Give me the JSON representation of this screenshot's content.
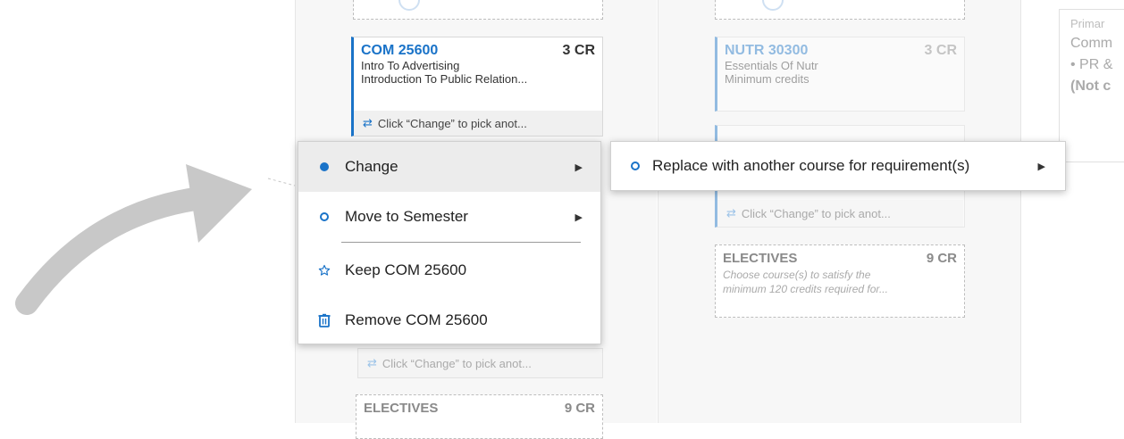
{
  "column_a": {
    "course_card": {
      "code": "COM 25600",
      "credits": "3 CR",
      "line1": "Intro To Advertising",
      "line2": "Introduction To Public Relation...",
      "hint": "Click “Change” to pick anot..."
    },
    "hint_below": "Click “Change” to pick anot...",
    "electives": {
      "title": "ELECTIVES",
      "credits": "9 CR"
    }
  },
  "column_b": {
    "course_card": {
      "code": "NUTR 30300",
      "credits": "3 CR",
      "line1": "Essentials Of Nutr",
      "line2": "Minimum credits"
    },
    "hint": "Click “Change” to pick anot...",
    "electives": {
      "title": "ELECTIVES",
      "credits": "9 CR",
      "desc_line1": "Choose course(s) to satisfy the",
      "desc_line2": "minimum 120 credits required for..."
    }
  },
  "side_panel": {
    "line1": "Primar",
    "line2": "Comm",
    "line3": "• PR &",
    "line4": "(Not c"
  },
  "context_menu": {
    "change_label": "Change",
    "move_label": "Move to Semester",
    "keep_label": "Keep COM 25600",
    "remove_label": "Remove COM 25600"
  },
  "submenu": {
    "replace_label": "Replace with another course for requirement(s)"
  },
  "icons": {
    "swap": "swap-arrows-icon",
    "star": "star-outline-icon",
    "trash": "trash-icon",
    "submenu_arrow": "caret-right-icon"
  },
  "colors": {
    "accent": "#1a73c8",
    "arrow_gray": "#c8c8c8"
  }
}
